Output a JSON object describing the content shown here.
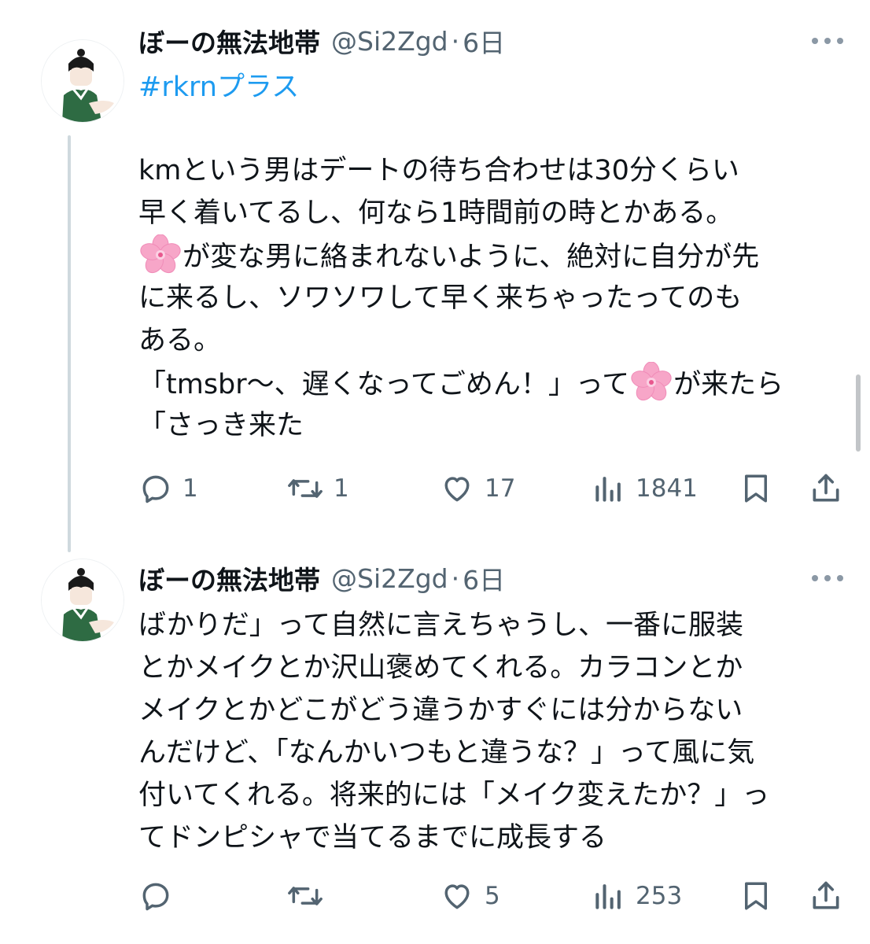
{
  "tweets": [
    {
      "display_name": "ぼーの無法地帯",
      "handle": "@Si2Zgd",
      "separator": "·",
      "time": "6日",
      "hashtag": "#rkrnプラス",
      "lines": [
        {
          "text": "kmという男はデートの待ち合わせは30分くらい"
        },
        {
          "text": "早く着いてるし、何なら1時間前の時とかある。"
        },
        {
          "before": "",
          "emoji": "cherry-blossom",
          "after": "が変な男に絡まれないように、絶対に自分が先"
        },
        {
          "text": "に来るし、ソワソワして早く来ちゃったってのも"
        },
        {
          "text": "ある。"
        },
        {
          "before": "「tmsbr〜、遅くなってごめん！」って",
          "emoji": "cherry-blossom",
          "after": "が来たら"
        },
        {
          "text": "「さっき来た"
        }
      ],
      "actions": {
        "reply": "1",
        "retweet": "1",
        "like": "17",
        "views": "1841"
      }
    },
    {
      "display_name": "ぼーの無法地帯",
      "handle": "@Si2Zgd",
      "separator": "·",
      "time": "6日",
      "lines": [
        {
          "text": "ばかりだ」って自然に言えちゃうし、一番に服装"
        },
        {
          "text": "とかメイクとか沢山褒めてくれる。カラコンとか"
        },
        {
          "text": "メイクとかどこがどう違うかすぐには分からない"
        },
        {
          "text": "んだけど、「なんかいつもと違うな？」って風に気"
        },
        {
          "text": "付いてくれる。将来的には「メイク変えたか？」っ"
        },
        {
          "text": "てドンピシャで当てるまでに成長する"
        }
      ],
      "actions": {
        "reply": "",
        "retweet": "",
        "like": "5",
        "views": "253"
      }
    }
  ],
  "colors": {
    "text": "#0f1419",
    "secondary": "#536471",
    "hashtag": "#1d9bf0",
    "thread_line": "#cfd9de",
    "blossom": "#f7a6c8"
  },
  "icons": [
    "more-icon",
    "reply-icon",
    "retweet-icon",
    "like-icon",
    "views-icon",
    "bookmark-icon",
    "share-icon",
    "cherry-blossom-emoji"
  ]
}
